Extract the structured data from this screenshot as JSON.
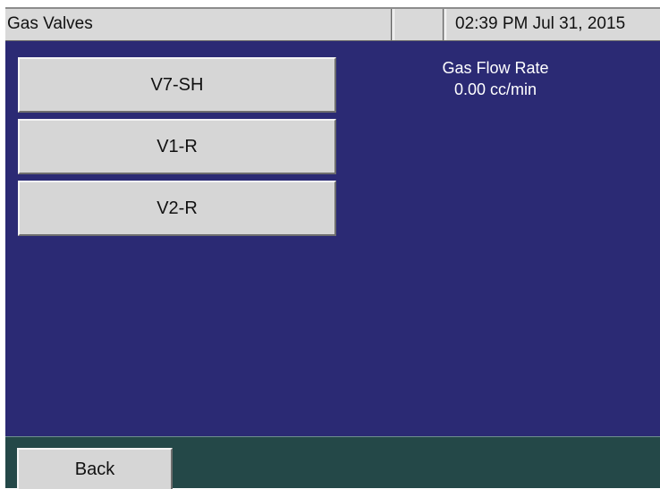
{
  "header": {
    "title": "Gas Valves",
    "status_cell": "",
    "datetime": "02:39 PM Jul 31, 2015"
  },
  "valves": [
    {
      "label": "V7-SH"
    },
    {
      "label": "V1-R"
    },
    {
      "label": "V2-R"
    }
  ],
  "flow": {
    "label": "Gas Flow Rate",
    "value": "0.00 cc/min"
  },
  "footer": {
    "back_label": "Back"
  },
  "colors": {
    "main_background": "#2b2a74",
    "footer_background": "#244848",
    "button_face": "#d6d6d6",
    "title_bar": "#d9d9d9"
  }
}
